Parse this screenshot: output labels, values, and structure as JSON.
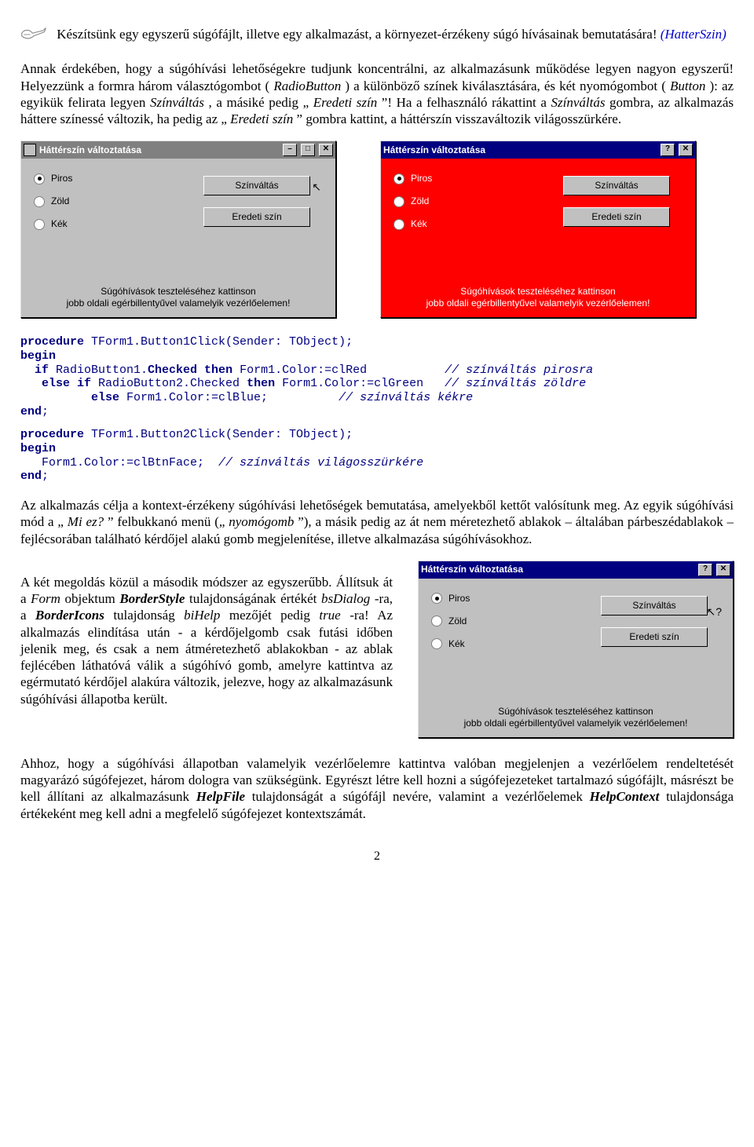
{
  "intro": {
    "lead1": "Készítsünk egy egyszerű súgófájlt, illetve egy alkalmazást, a környezet-érzékeny súgó hívásainak bemutatására! ",
    "lead_link": "(HatterSzin)",
    "p2a": "Annak érdekében, hogy a súgóhívási lehetőségekre tudjunk koncentrálni, az alkalmazásunk működése legyen nagyon egyszerű! Helyezzünk a formra három választógombot (",
    "p2b": ") a különböző színek kiválasztására, és két nyomógombot (",
    "p2c": "): az egyikük felirata legyen ",
    "p2d": ", a másiké pedig „",
    "p2e": "”! Ha a felhasználó rákattint a ",
    "p2f": " gombra, az alkalmazás háttere színessé változik, ha pedig az „",
    "p2g": "” gombra kattint, a háttérszín visszaváltozik világosszürkére.",
    "RadioButton": "RadioButton",
    "Button": "Button",
    "Szinvaltas_em": "Színváltás",
    "Eredeti_em": "Eredeti szín"
  },
  "win": {
    "title_design": "Háttérszín változtatása",
    "title_run": "Háttérszín változtatása",
    "opt1": "Piros",
    "opt2": "Zöld",
    "opt3": "Kék",
    "btn1": "Színváltás",
    "btn2": "Eredeti szín",
    "hint1": "Súgóhívások teszteléséhez kattinson",
    "hint2": "jobb oldali egérbillentyűvel valamelyik vezérlőelemen!",
    "close": "✕",
    "min": "–",
    "max": "□",
    "help": "?"
  },
  "code1": {
    "l1a": "procedure",
    "l1b": " TForm1.Button1Click(Sender: TObject);",
    "l2": "begin",
    "l3a": "  if",
    "l3b": " RadioButton1.",
    "l3c": "Checked then",
    "l3d": " Form1.Color:=clRed           ",
    "l3e": "// színváltás pirosra",
    "l4a": "   else if",
    "l4b": " RadioButton2.Checked ",
    "l4c": "then",
    "l4d": " Form1.Color:=clGreen   ",
    "l4e": "// színváltás zöldre",
    "l5a": "          else",
    "l5b": " Form1.Color:=clBlue;          ",
    "l5e": "// színváltás kékre",
    "l6": "end",
    "semi": ";"
  },
  "code2": {
    "l1a": "procedure",
    "l1b": " TForm1.Button2Click(Sender: TObject);",
    "l2": "begin",
    "l3a": "   Form1.Color:=clBtnFace;  ",
    "l3e": "// színváltás világosszürkére",
    "l4": "end",
    "semi": ";"
  },
  "body2": {
    "p1a": "Az alkalmazás célja a kontext-érzékeny súgóhívási lehetőségek bemutatása, amelyekből kettőt valósítunk meg. Az egyik súgóhívási mód a „",
    "p1_em1": "Mi ez?",
    "p1b": "” felbukkanó menü („",
    "p1_em2": "nyomógomb",
    "p1c": "”), a másik pedig az át nem méretezhető ablakok – általában párbeszédablakok – fejlécsorában található kérdőjel alakú gomb megjelenítése, illetve alkalmazása súgóhívásokhoz.",
    "p2a": "A két megoldás közül a második módszer az egyszerűbb. Állítsuk át a ",
    "p2_em_form": "Form",
    "p2b": " objektum ",
    "p2_bi_bs": "BorderStyle",
    "p2c": " tulajdonságának értékét ",
    "p2_em_bsd": "bsDialog",
    "p2d": "-ra, a ",
    "p2_bi_bi": "BorderIcons",
    "p2e": " tulajdonság ",
    "p2_em_bih": "biHelp",
    "p2f": " mezőjét pedig ",
    "p2_em_true": "true",
    "p2g": "-ra! Az alkalmazás elindítása után - a kérdőjelgomb csak futási időben jelenik meg, és csak a nem átméretezhető ablakokban - az ablak fejlécében láthatóvá válik a súgóhívó gomb, amelyre kattintva az egérmutató kérdőjel alakúra változik, jelezve, hogy az alkalmazásunk súgóhívási állapotba került.",
    "p3a": "Ahhoz, hogy a súgóhívási állapotban valamelyik vezérlőelemre kattintva valóban megjelenjen a vezérlőelem rendeltetését magyarázó súgófejezet, három dologra van szükségünk. Egyrészt létre kell hozni a súgófejezeteket tartalmazó súgófájlt, másrészt be kell állítani az alkalmazásunk ",
    "p3_bi_hf": "HelpFile",
    "p3b": " tulajdonságát a súgófájl nevére, valamint a vezérlőelemek ",
    "p3_bi_hc": "HelpContext",
    "p3c": " tulajdonsága értékeként meg kell adni a megfelelő súgófejezet kontextszámát."
  },
  "pagenum": "2"
}
